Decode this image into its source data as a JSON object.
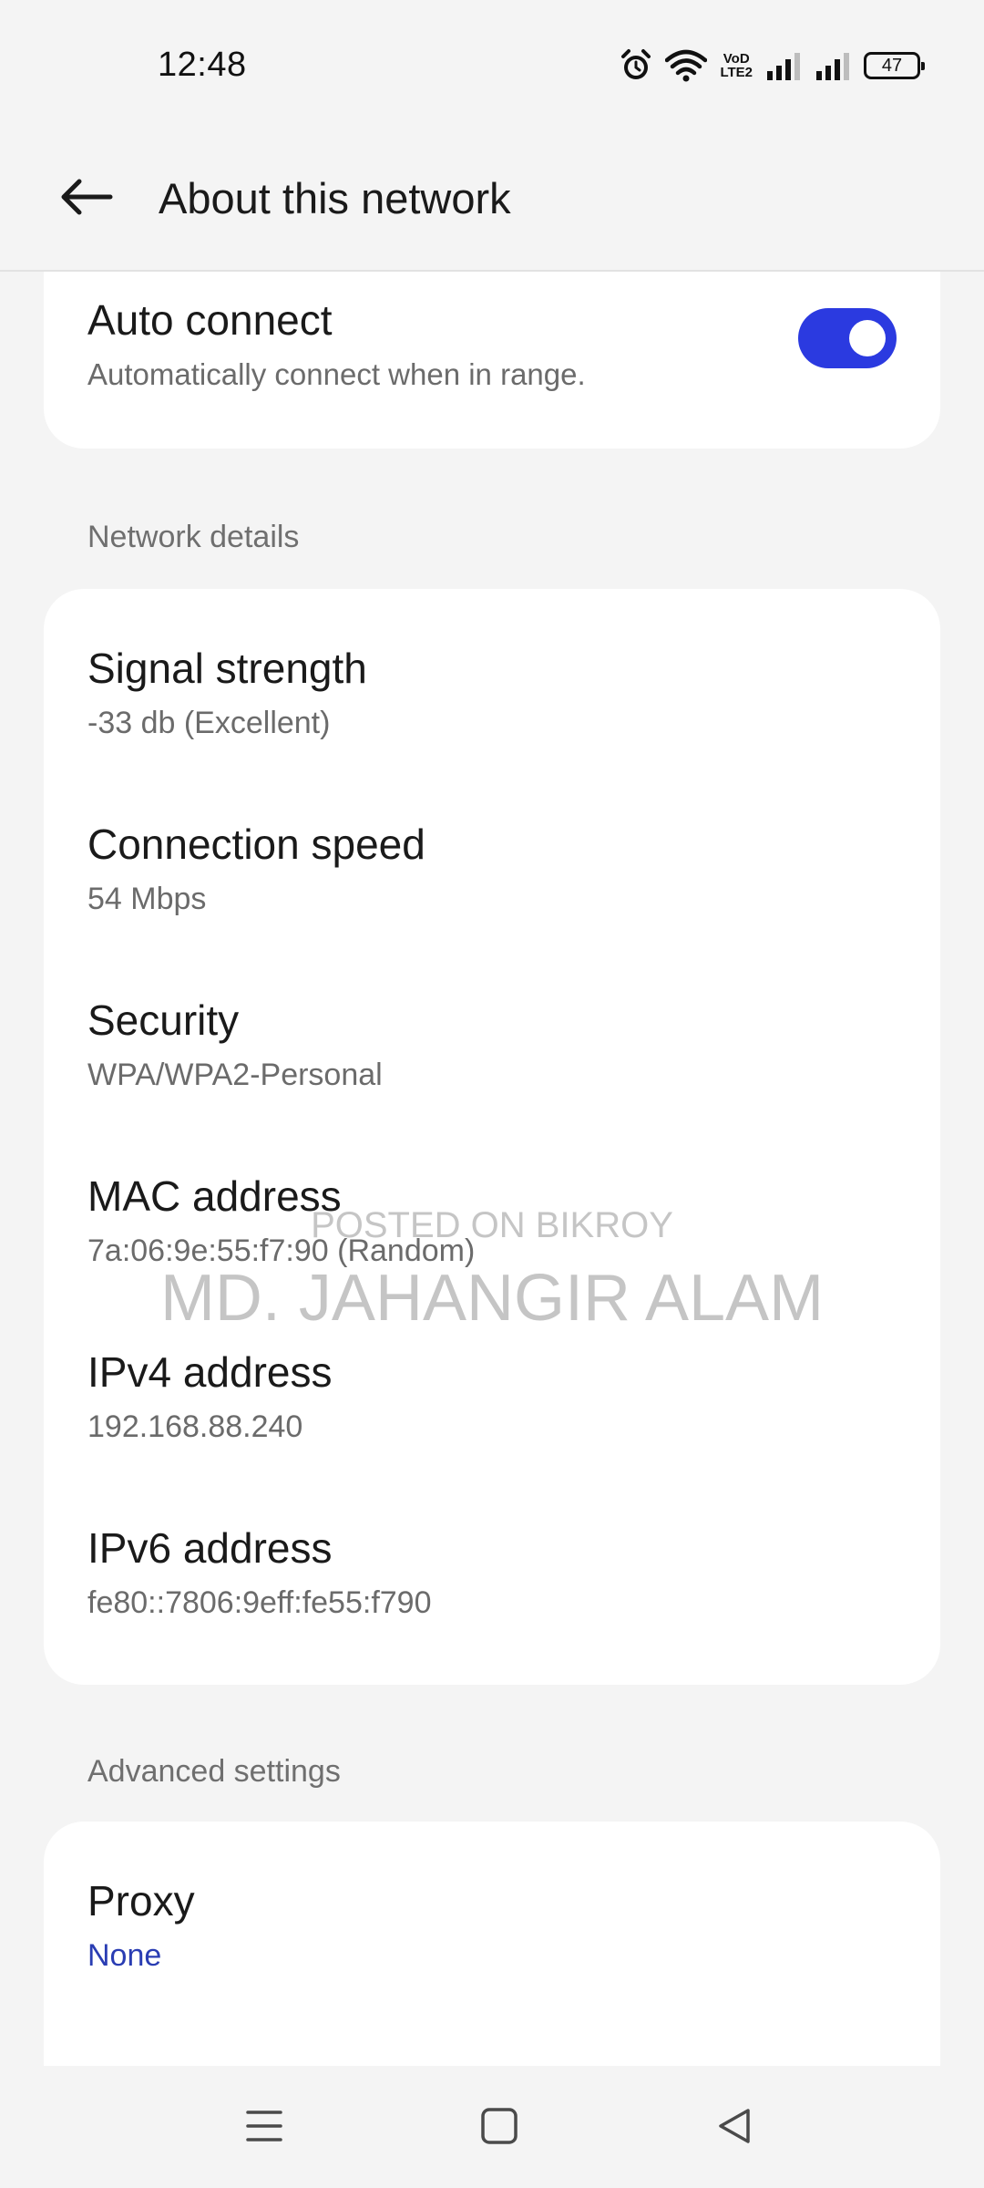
{
  "status_bar": {
    "time": "12:48",
    "battery_level": "47",
    "volte_top": "VoD",
    "volte_bottom": "LTE2",
    "icons": [
      "alarm-icon",
      "wifi-icon",
      "volte-icon",
      "signal-icon",
      "signal-icon",
      "battery-icon"
    ]
  },
  "app_bar": {
    "title": "About this network",
    "back_icon": "back-arrow-icon"
  },
  "auto_connect": {
    "title": "Auto connect",
    "subtitle": "Automatically connect when in range.",
    "enabled": true,
    "toggle_color": "#2b3ae0"
  },
  "network_details": {
    "label": "Network details",
    "items": [
      {
        "title": "Signal strength",
        "value": "-33 db (Excellent)"
      },
      {
        "title": "Connection speed",
        "value": "54 Mbps"
      },
      {
        "title": "Security",
        "value": "WPA/WPA2-Personal"
      },
      {
        "title": "MAC address",
        "value": "7a:06:9e:55:f7:90 (Random)"
      },
      {
        "title": "IPv4 address",
        "value": "192.168.88.240"
      },
      {
        "title": "IPv6 address",
        "value": "fe80::7806:9eff:fe55:f790"
      }
    ]
  },
  "advanced_settings": {
    "label": "Advanced settings",
    "proxy_title": "Proxy",
    "proxy_value": "None",
    "proxy_color": "#2a3db3"
  },
  "watermark": {
    "line1": "POSTED ON BIKROY",
    "line2": "MD. JAHANGIR ALAM"
  },
  "nav_bar": {
    "icons": [
      "menu-icon",
      "home-icon",
      "back-triangle-icon"
    ]
  }
}
